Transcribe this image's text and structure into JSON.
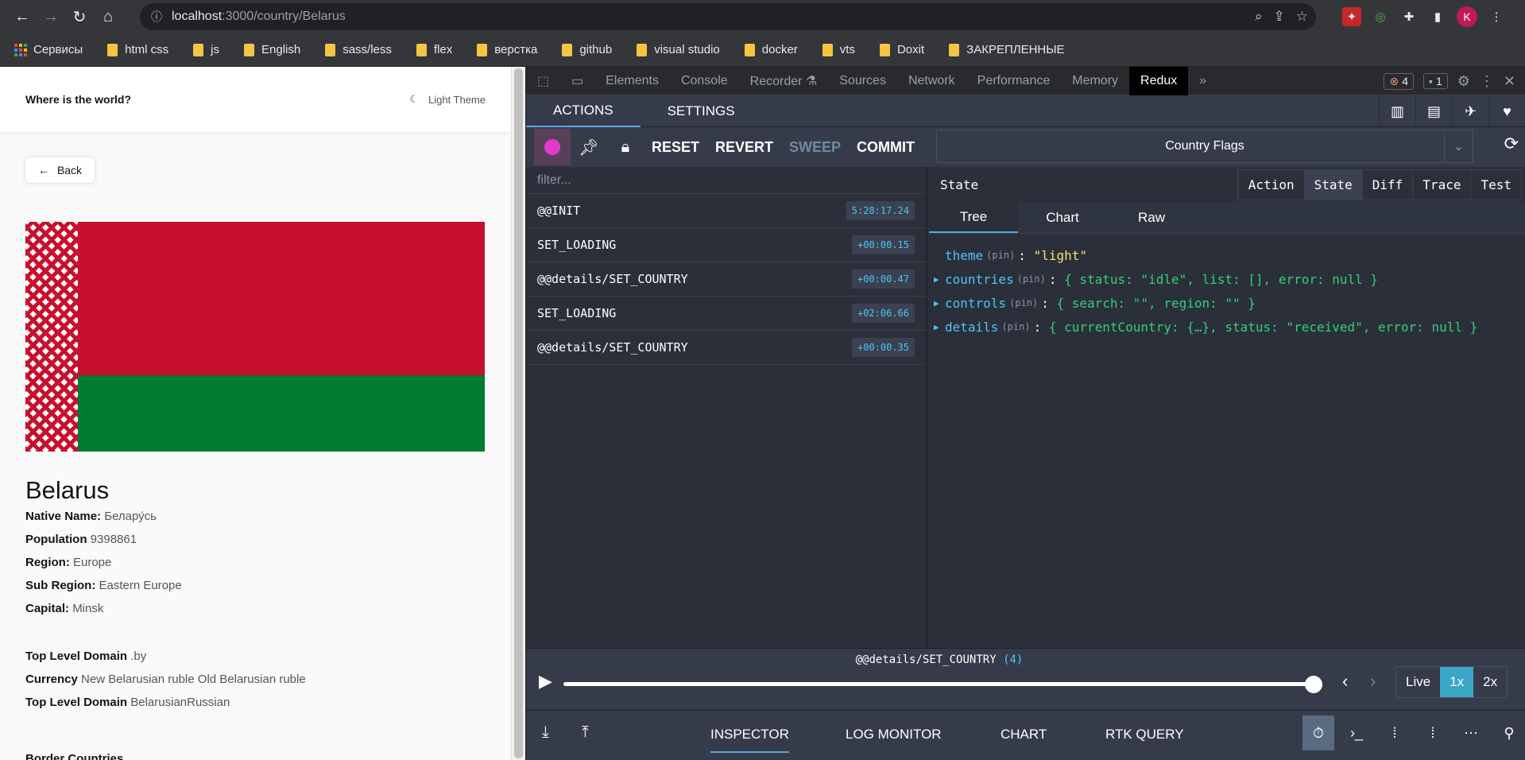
{
  "browser": {
    "url_host": "localhost",
    "url_path": ":3000/country/Belarus",
    "avatar_letter": "K"
  },
  "bookmarks": [
    "Сервисы",
    "html css",
    "js",
    "English",
    "sass/less",
    "flex",
    "верстка",
    "github",
    "visual studio",
    "docker",
    "vts",
    "Doxit",
    "ЗАКРЕПЛЕННЫЕ"
  ],
  "page": {
    "logo": "Where is the world?",
    "theme_label": "Light Theme",
    "back_label": "Back",
    "country": "Belarus",
    "native_name_label": "Native Name:",
    "native_name": "Белару́сь",
    "population_label": "Population",
    "population": "9398861",
    "region_label": "Region:",
    "region": "Europe",
    "subregion_label": "Sub Region:",
    "subregion": "Eastern Europe",
    "capital_label": "Capital:",
    "capital": "Minsk",
    "tld_label": "Top Level Domain",
    "tld": ".by",
    "currency_label": "Currency",
    "currency": "New Belarusian ruble Old Belarusian ruble",
    "lang_label": "Top Level Domain",
    "languages": "BelarusianRussian",
    "border_label": "Border Countries"
  },
  "devtools": {
    "tabs": [
      "Elements",
      "Console",
      "Recorder ⚗",
      "Sources",
      "Network",
      "Performance",
      "Memory",
      "Redux"
    ],
    "active_tab": "Redux",
    "errors": "4",
    "messages": "1"
  },
  "redux": {
    "top_tabs": [
      "ACTIONS",
      "SETTINGS"
    ],
    "toolbar": {
      "reset": "RESET",
      "revert": "REVERT",
      "sweep": "SWEEP",
      "commit": "COMMIT"
    },
    "instance": "Country Flags",
    "filter_placeholder": "filter...",
    "actions": [
      {
        "name": "@@INIT",
        "time": "5:28:17.24"
      },
      {
        "name": "SET_LOADING",
        "time": "+00:00.15"
      },
      {
        "name": "@@details/SET_COUNTRY",
        "time": "+00:00.47"
      },
      {
        "name": "SET_LOADING",
        "time": "+02:06.66"
      },
      {
        "name": "@@details/SET_COUNTRY",
        "time": "+00:00.35"
      }
    ],
    "state_title": "State",
    "monitor_tabs": [
      "Action",
      "State",
      "Diff",
      "Trace",
      "Test"
    ],
    "view_tabs": [
      "Tree",
      "Chart",
      "Raw"
    ],
    "tree": [
      {
        "key": "theme",
        "pin": "(pin)",
        "value": "\"light\""
      },
      {
        "key": "countries",
        "pin": "(pin)",
        "value": "{ status: \"idle\", list: [], error: null }"
      },
      {
        "key": "controls",
        "pin": "(pin)",
        "value": "{ search: \"\", region: \"\" }"
      },
      {
        "key": "details",
        "pin": "(pin)",
        "value": "{ currentCountry: {…}, status: \"received\", error: null }"
      }
    ],
    "slider_action": "@@details/SET_COUNTRY",
    "slider_index": "(4)",
    "speeds": [
      "Live",
      "1x",
      "2x"
    ],
    "bottom_tabs": [
      "INSPECTOR",
      "LOG MONITOR",
      "CHART",
      "RTK QUERY"
    ]
  }
}
